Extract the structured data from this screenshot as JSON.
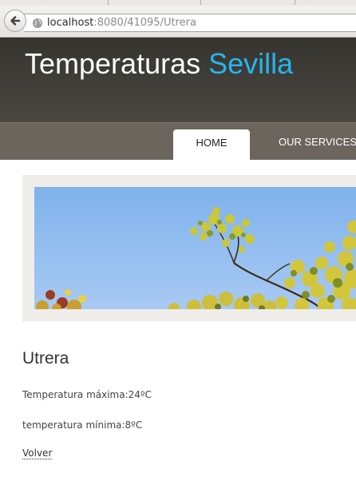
{
  "browser": {
    "url_host": "localhost",
    "url_rest": ":8080/41095/Utrera"
  },
  "site": {
    "brand_main": "Temperaturas",
    "brand_accent": "Sevilla",
    "accent_color": "#25b5ef"
  },
  "menu": {
    "items": [
      "HOME",
      "OUR SERVICES"
    ]
  },
  "content": {
    "city": "Utrera",
    "max_temp": "Temperatura máxima:24ºC",
    "min_temp": "temperatura mínima:8ºC",
    "back_link": "Volver"
  },
  "icons": {
    "back": "back-arrow-icon",
    "site": "globe-icon"
  }
}
